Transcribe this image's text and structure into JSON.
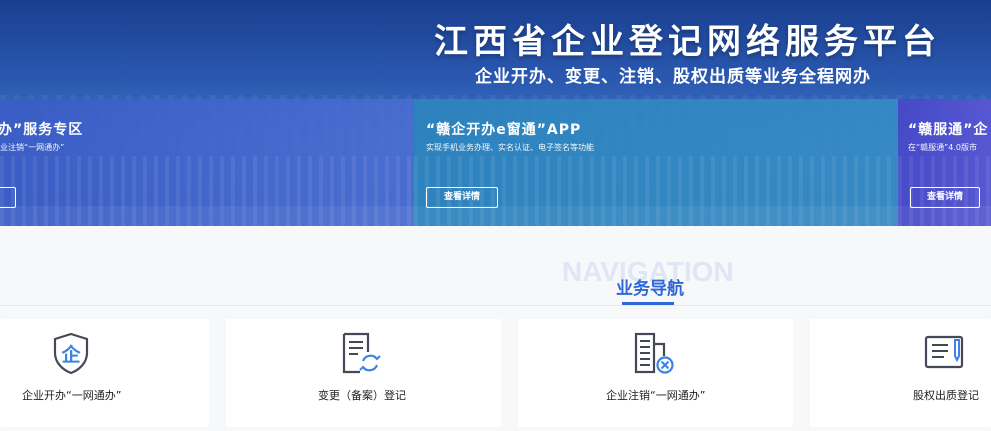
{
  "hero": {
    "title": "江西省企业登记网络服务平台",
    "subtitle": "企业开办、变更、注销、股权出质等业务全程网办"
  },
  "cards": [
    {
      "title": "办”服务专区",
      "desc": "业注销“一网通办”",
      "button": ""
    },
    {
      "title": "“赣企开办e窗通”APP",
      "desc": "实现手机业务办理、实名认证、电子签名等功能",
      "button": "查看详情"
    },
    {
      "title": "“赣服通”企",
      "desc": "在“赣服通”4.0版市",
      "button": "查看详情"
    }
  ],
  "navigation": {
    "watermark": "NAVIGATION",
    "heading": "业务导航",
    "tiles": [
      {
        "label": "企业开办“一网通办”",
        "icon": "enterprise-shield-icon"
      },
      {
        "label": "变更（备案）登记",
        "icon": "document-refresh-icon"
      },
      {
        "label": "企业注销“一网通办”",
        "icon": "building-cancel-icon"
      },
      {
        "label": "股权出质登记",
        "icon": "form-pen-icon"
      }
    ]
  },
  "colors": {
    "accent": "#2f67d6",
    "icon_stroke": "#444a55",
    "icon_accent": "#3a82e6"
  }
}
